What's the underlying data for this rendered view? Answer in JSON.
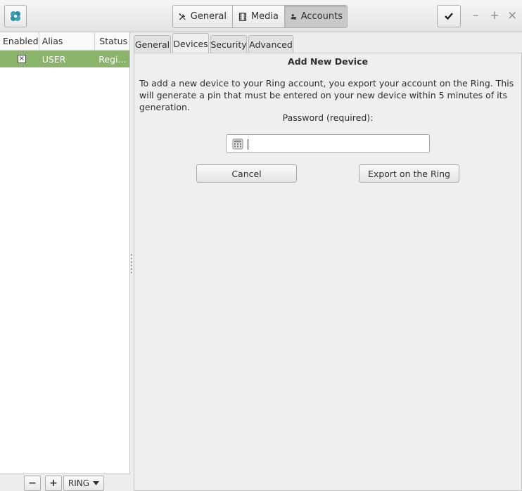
{
  "header": {
    "app_icon": "ring-logo-icon",
    "nav": [
      {
        "label": "General",
        "icon": "tools-icon"
      },
      {
        "label": "Media",
        "icon": "film-icon"
      },
      {
        "label": "Accounts",
        "icon": "accounts-icon"
      }
    ],
    "active_nav": "Accounts",
    "confirm_icon": "checkmark-icon",
    "window_controls": [
      "–",
      "+",
      "×"
    ]
  },
  "accounts": {
    "columns": [
      "Enabled",
      "Alias",
      "Status"
    ],
    "rows": [
      {
        "enabled": "×",
        "alias": "USER",
        "status": "Regi..."
      }
    ],
    "selected_row_color": "#8ab46a",
    "bottom": {
      "remove": "−",
      "add": "+",
      "type": "RING"
    }
  },
  "tabs": [
    "General",
    "Devices",
    "Security",
    "Advanced"
  ],
  "active_tab": "Devices",
  "devices": {
    "title": "Add New Device",
    "description": "To add a new device to your Ring account, you export your account on the Ring. This will generate a pin that must be entered on your new device within 5 minutes of its generation.",
    "password_label": "Password (required):",
    "password_value": "",
    "cancel_label": "Cancel",
    "export_label": "Export on the Ring"
  }
}
